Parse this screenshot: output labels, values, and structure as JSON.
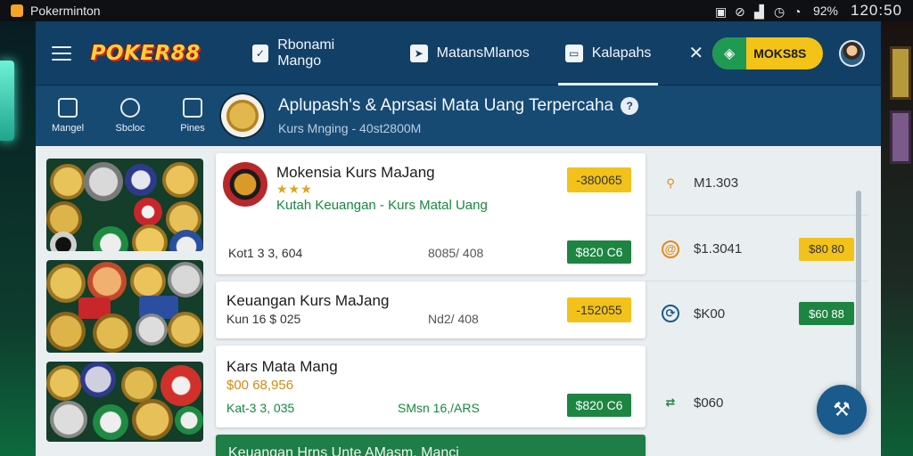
{
  "status_bar": {
    "app_name": "Pokerminton",
    "clock": "120:50",
    "battery": "92%",
    "icons": [
      "alarm-icon",
      "mute-icon",
      "wifi-icon",
      "signal-icon"
    ]
  },
  "topbar": {
    "logo": "POKER88",
    "tabs": [
      {
        "label": "Rbonami Mango",
        "icon": "check-icon",
        "active": false
      },
      {
        "label": "MatansMlanos",
        "icon": "send-icon",
        "active": false
      },
      {
        "label": "Kalapahs",
        "icon": "chat-icon",
        "active": true
      }
    ],
    "mode_button": "MOKS8S"
  },
  "quicknav": [
    {
      "label": "Mangel",
      "icon": "home-icon"
    },
    {
      "label": "Sbcloc",
      "icon": "compass-icon"
    },
    {
      "label": "Pines",
      "icon": "document-icon"
    }
  ],
  "hero": {
    "title": "Aplupash's & Aprsasi Mata Uang Terpercaha",
    "subtitle": "Kurs Mnging - 40st2800M"
  },
  "cards": [
    {
      "title": "Mokensia Kurs MaJang",
      "rating": "★★★",
      "category": "Kutah Keuangan - Kurs Matal Uang",
      "badge_top": "-380065",
      "left_meta": "Kot1 3 3, 604",
      "mid_meta": "8085/ 408",
      "badge_bottom": "$820 C6"
    },
    {
      "title": "Keuangan Kurs MaJang",
      "left_meta": "Kun 16 $ 025",
      "mid_meta": "Nd2/ 408",
      "badge_top": "-152055"
    },
    {
      "title": "Kars Mata Mang",
      "orange_value": "$00 68,956",
      "left_meta": "Kat-3 3, 035",
      "mid_meta": "SMsn 16,/ARS",
      "badge_bottom": "$820 C6"
    },
    {
      "title": "Keuangan Hrns Unte AMasm, Manci"
    }
  ],
  "rates": [
    {
      "icon": "pin-icon",
      "value": "M1.303",
      "badge": ""
    },
    {
      "icon": "target-icon",
      "value": "$1.3041",
      "badge": "$80 80"
    },
    {
      "icon": "clock-icon",
      "value": "$K00",
      "badge": "$60 88"
    },
    {
      "icon": "refresh-icon",
      "value": "$060",
      "badge": ""
    }
  ],
  "colors": {
    "topbar": "#123f66",
    "subheader": "#174a73",
    "accent_yellow": "#f2c21a",
    "accent_green": "#1d8442"
  }
}
